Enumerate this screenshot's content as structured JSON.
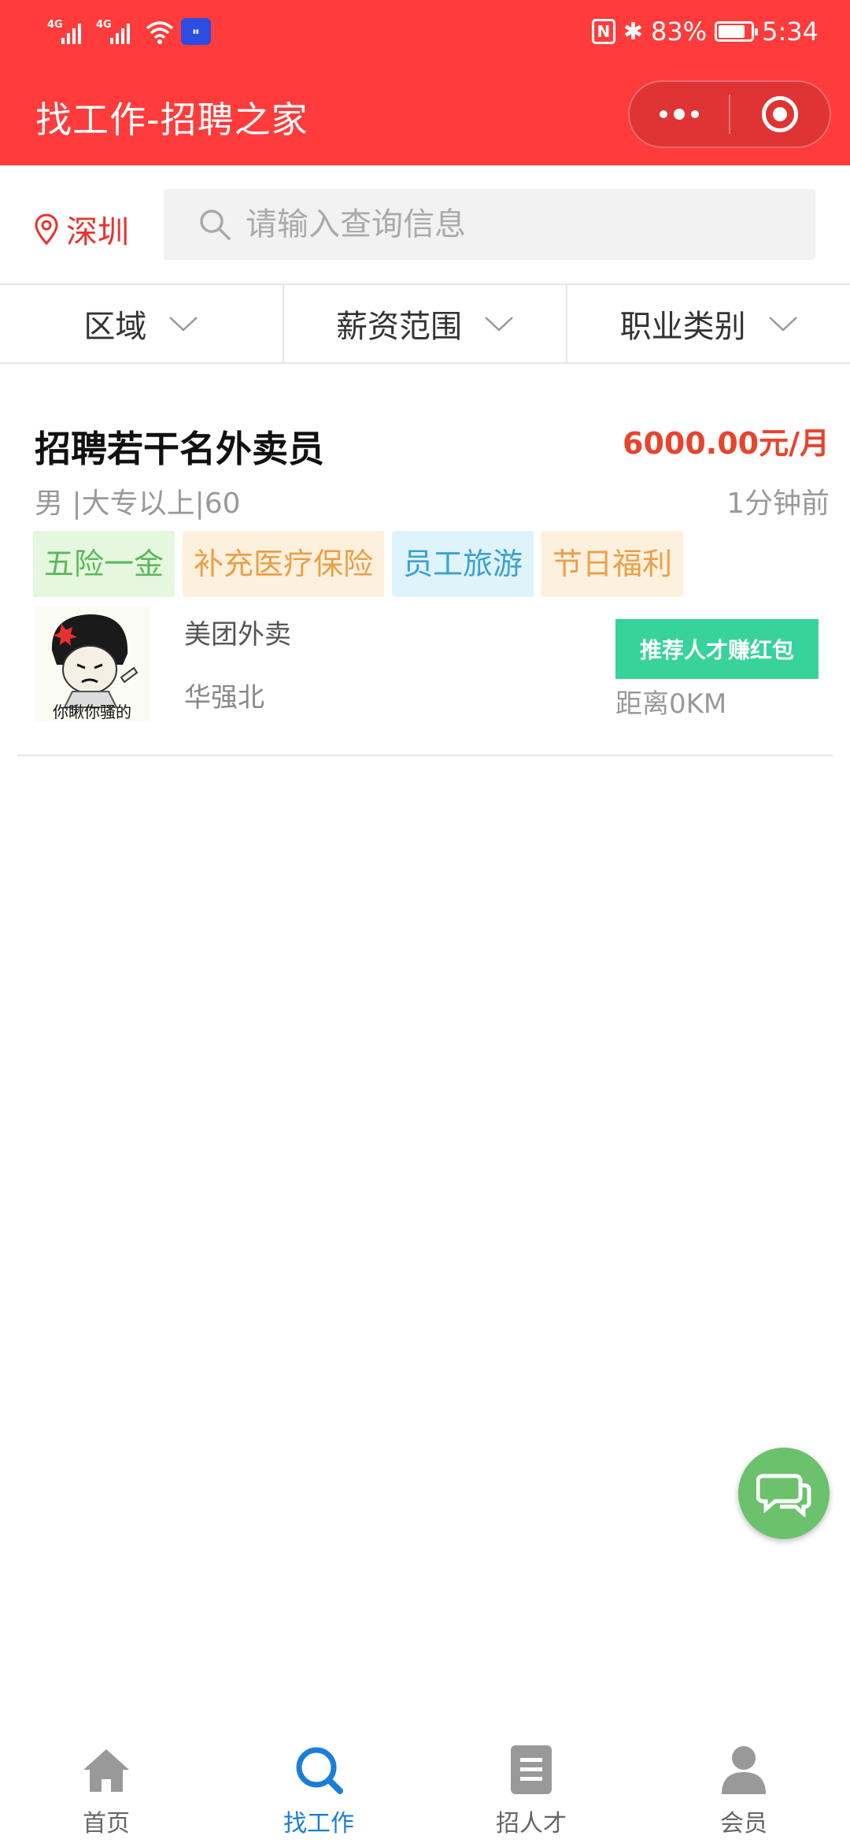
{
  "status_bar": {
    "network_1": "4G",
    "network_2": "4G",
    "battery": "83%",
    "time": "5:34"
  },
  "header": {
    "title": "找工作-招聘之家"
  },
  "search": {
    "city": "深圳",
    "placeholder": "请输入查询信息",
    "value": ""
  },
  "filters": [
    {
      "label": "区域"
    },
    {
      "label": "薪资范围"
    },
    {
      "label": "职业类别"
    }
  ],
  "jobs": [
    {
      "title": "招聘若干名外卖员",
      "salary": "6000.00元/月",
      "meta": "男 |大专以上|60",
      "posted": "1分钟前",
      "tags": [
        "五险一金",
        "补充医疗保险",
        "员工旅游",
        "节日福利"
      ],
      "avatar_caption": "你瞅你骚的",
      "company": "美团外卖",
      "location": "华强北",
      "recommend_label": "推荐人才赚红包",
      "distance": "距离0KM"
    }
  ],
  "tabbar": {
    "items": [
      {
        "label": "首页",
        "icon": "home-icon"
      },
      {
        "label": "找工作",
        "icon": "search-icon"
      },
      {
        "label": "招人才",
        "icon": "document-icon"
      },
      {
        "label": "会员",
        "icon": "user-icon"
      }
    ],
    "active_index": 1
  },
  "colors": {
    "brand": "#ff3b3b",
    "salary": "#e8432e",
    "recommend": "#37d39a",
    "chat": "#6cc16c",
    "tab_active": "#1a7ed6"
  }
}
